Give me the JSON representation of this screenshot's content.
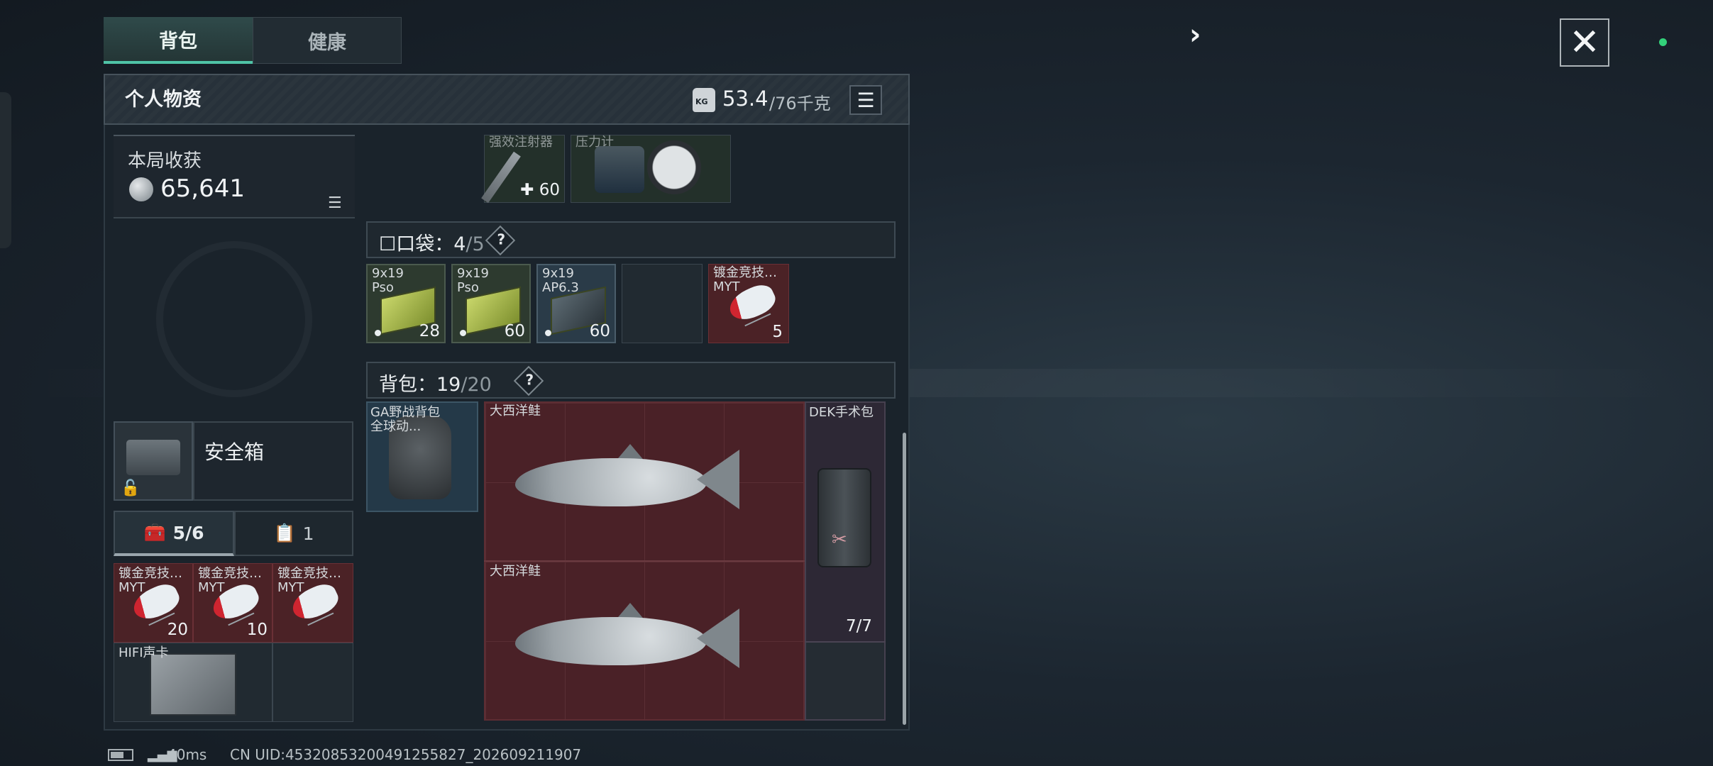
{
  "tabs": [
    {
      "label": "背包",
      "active": true
    },
    {
      "label": "健康",
      "active": false
    }
  ],
  "header": {
    "title": "个人物资",
    "weight_current": "53.4",
    "weight_max": "/76千克",
    "weight_icon_text": "KG",
    "list_icon": "list-icon"
  },
  "earnings": {
    "label": "本局收获",
    "value": "65,641",
    "coin_icon": "coin-icon"
  },
  "secure": {
    "label": "安全箱",
    "lock_icon": "padlock-icon"
  },
  "subtabs": [
    {
      "label": "5/6",
      "icon": "toolbox-icon"
    },
    {
      "label": "1",
      "icon": "clipboard-icon"
    }
  ],
  "secure_items": [
    {
      "name": "镀金竞技…",
      "sub": "MYT",
      "qty": "20"
    },
    {
      "name": "镀金竞技…",
      "sub": "MYT",
      "qty": "10"
    },
    {
      "name": "镀金竞技…",
      "sub": "MYT",
      "qty": ""
    },
    {
      "name": "HIFI声卡",
      "sub": "",
      "qty": ""
    }
  ],
  "top_items": [
    {
      "name": "强效注射器",
      "qty": "60",
      "prefix": "✚"
    },
    {
      "name": "压力计",
      "qty": ""
    }
  ],
  "pocket": {
    "label": "口袋：",
    "used": "4",
    "total": "/5",
    "help": "?"
  },
  "pocket_items": [
    {
      "name": "9x19",
      "sub": "Pso",
      "qty": "28"
    },
    {
      "name": "9x19",
      "sub": "Pso",
      "qty": "60"
    },
    {
      "name": "9x19",
      "sub": "AP6.3",
      "qty": "60"
    },
    {
      "name": "",
      "sub": "",
      "qty": ""
    },
    {
      "name": "镀金竞技…",
      "sub": "MYT",
      "qty": "5"
    }
  ],
  "backpack": {
    "label": "背包：",
    "used": "19",
    "total": "/20",
    "help": "?"
  },
  "backpack_items": [
    {
      "name": "GA野战背包",
      "sub": "全球动..."
    },
    {
      "name": "大西洋鲑"
    },
    {
      "name": "大西洋鲑"
    },
    {
      "name": "DEK手术包",
      "qty": "7/7"
    }
  ],
  "topbar": {
    "arrow": "›",
    "close": "✕"
  },
  "status": {
    "ping": "40ms",
    "uid": "CN UID:45320853200491255827_202609211907"
  },
  "colors": {
    "accent": "#4fc3a6",
    "status_dot": "#33d17a",
    "rare_red": "#4b2226"
  }
}
